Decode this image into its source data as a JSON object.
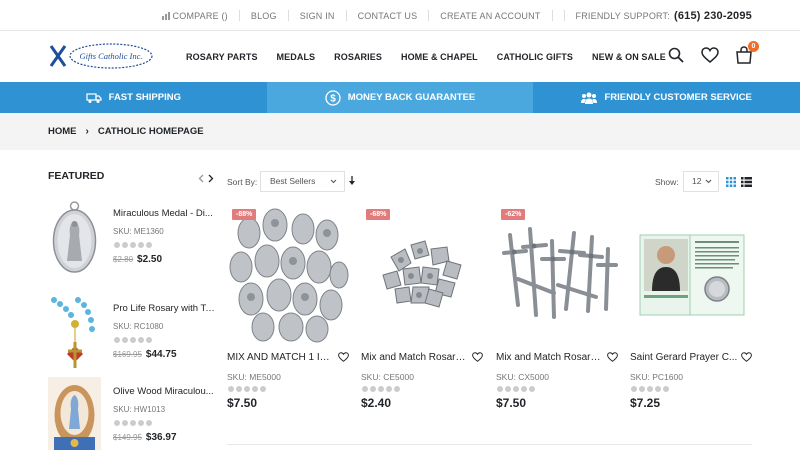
{
  "topbar": {
    "compare": "COMPARE ()",
    "blog": "BLOG",
    "sign_in": "SIGN IN",
    "contact": "CONTACT US",
    "create_account": "CREATE AN ACCOUNT",
    "support_label": "FRIENDLY SUPPORT:",
    "phone": "(615) 230-2095"
  },
  "logo": {
    "text": "Gifts Catholic Inc."
  },
  "nav": {
    "items": [
      "ROSARY PARTS",
      "MEDALS",
      "ROSARIES",
      "HOME & CHAPEL",
      "CATHOLIC GIFTS",
      "NEW & ON SALE"
    ]
  },
  "header": {
    "cart_count": "0"
  },
  "infobar": {
    "shipping": "FAST SHIPPING",
    "guarantee": "MONEY BACK GUARANTEE",
    "service": "FRIENDLY CUSTOMER SERVICE"
  },
  "breadcrumb": {
    "home": "HOME",
    "current": "CATHOLIC HOMEPAGE"
  },
  "featured": {
    "title": "FEATURED",
    "items": [
      {
        "name": "Miraculous Medal - Di...",
        "sku": "SKU: ME1360",
        "old_price": "$2.80",
        "price": "$2.50"
      },
      {
        "name": "Pro Life Rosary with Te...",
        "sku": "SKU: RC1080",
        "old_price": "$169.95",
        "price": "$44.75"
      },
      {
        "name": "Olive Wood Miraculou...",
        "sku": "SKU: HW1013",
        "old_price": "$149.95",
        "price": "$36.97"
      }
    ]
  },
  "toolbar": {
    "sort_label": "Sort By:",
    "sort_value": "Best Sellers",
    "show_label": "Show:",
    "show_value": "12"
  },
  "products": [
    {
      "badge": "-88%",
      "name": "MIX AND MATCH 1 Inch ...",
      "sku": "SKU: ME5000",
      "price": "$7.50"
    },
    {
      "badge": "-68%",
      "name": "Mix and Match Rosary ...",
      "sku": "SKU: CE5000",
      "price": "$2.40"
    },
    {
      "badge": "-62%",
      "name": "Mix and Match Rosary ...",
      "sku": "SKU: CX5000",
      "price": "$7.50"
    },
    {
      "badge": "",
      "name": "Saint Gerard Prayer C...",
      "sku": "SKU: PC1600",
      "price": "$7.25"
    }
  ],
  "colors": {
    "accent_blue": "#2f93d3",
    "badge": "#e27c7c",
    "cart_badge": "#f06c27"
  }
}
